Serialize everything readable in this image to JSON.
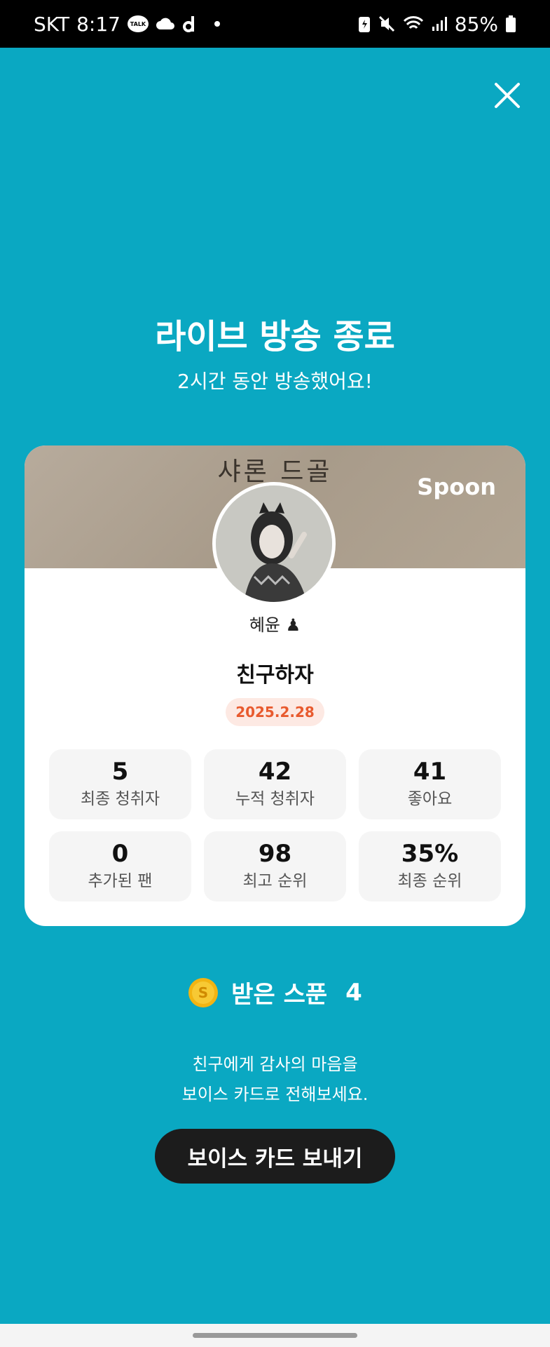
{
  "status_bar": {
    "carrier": "SKT",
    "time": "8:17",
    "talk_icon_text": "TALK",
    "battery": "85%"
  },
  "header": {
    "title": "라이브 방송 종료",
    "subtitle": "2시간 동안 방송했어요!"
  },
  "card": {
    "banner_text": "샤론 드골",
    "brand": "Spoon",
    "nickname": "혜윤 ♟",
    "room_title": "친구하자",
    "date": "2025.2.28",
    "stats": [
      {
        "value": "5",
        "label": "최종 청취자"
      },
      {
        "value": "42",
        "label": "누적 청취자"
      },
      {
        "value": "41",
        "label": "좋아요"
      },
      {
        "value": "0",
        "label": "추가된 팬"
      },
      {
        "value": "98",
        "label": "최고 순위"
      },
      {
        "value": "35%",
        "label": "최종 순위"
      }
    ]
  },
  "spoons": {
    "label": "받은 스푼",
    "count": "4",
    "coin_letter": "S"
  },
  "thanks": {
    "line1": "친구에게 감사의 마음을",
    "line2": "보이스 카드로 전해보세요."
  },
  "actions": {
    "voice_card_button": "보이스 카드 보내기"
  },
  "colors": {
    "background": "#0aa8c2",
    "button": "#1c1c1c",
    "date_badge_bg": "#fde9e3",
    "date_badge_text": "#e85a2e"
  }
}
